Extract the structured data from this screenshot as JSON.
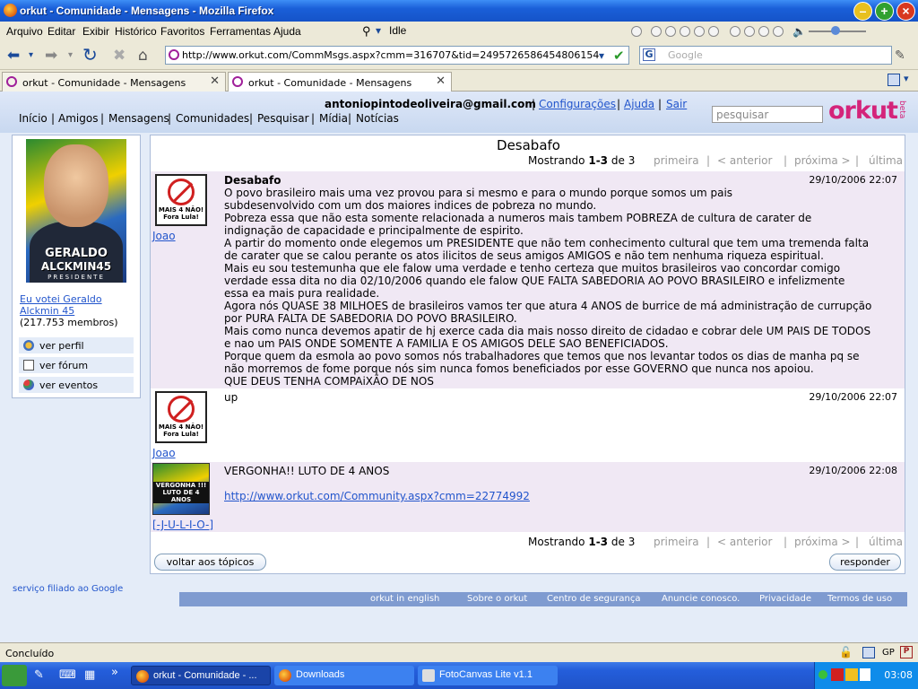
{
  "window": {
    "title": "orkut - Comunidade - Mensagens - Mozilla Firefox"
  },
  "menu": [
    "Arquivo",
    "Editar",
    "Exibir",
    "Histórico",
    "Favoritos",
    "Ferramentas",
    "Ajuda"
  ],
  "media_status": "Idle",
  "url": "http://www.orkut.com/CommMsgs.aspx?cmm=316707&tid=2495726586454806154",
  "search_placeholder": "Google",
  "tabs": [
    {
      "label": "orkut - Comunidade - Mensagens"
    },
    {
      "label": "orkut - Comunidade - Mensagens"
    }
  ],
  "header": {
    "email": "antoniopintodeoliveira@gmail.com",
    "links": [
      "Configurações",
      "Ajuda",
      "Sair"
    ],
    "nav": [
      "Início",
      "Amigos",
      "Mensagens",
      "Comunidades",
      "Pesquisar",
      "Mídia",
      "Notícias"
    ],
    "search_placeholder": "pesquisar",
    "logo": "orkut",
    "logo_beta": "beta"
  },
  "community": {
    "photo_text": [
      "GERALDO",
      "ALCKMIN45",
      "PRESIDENTE"
    ],
    "name": "Eu votei Geraldo Alckmin 45",
    "members": "(217.753 membros)",
    "actions": [
      "ver perfil",
      "ver fórum",
      "ver eventos"
    ]
  },
  "topic": {
    "title": "Desabafo",
    "pager": {
      "shown": "Mostrando",
      "range": "1-3",
      "of": "de",
      "total": "3",
      "first": "primeira",
      "prev": "< anterior",
      "next": "próxima >",
      "last": "última"
    },
    "posts": [
      {
        "author": "Joao",
        "avatar_text": [
          "MAIS 4 NÃO!",
          "Fora Lula!"
        ],
        "date": "29/10/2006 22:07",
        "subject": "Desabafo",
        "body": [
          "O povo brasileiro mais uma vez provou para si mesmo e para o mundo porque somos um pais",
          "subdesenvolvido com um dos maiores indices de pobreza no mundo.",
          "Pobreza essa que não esta somente relacionada a numeros mais tambem POBREZA de cultura de carater de",
          "indignação de capacidade e principalmente de espirito.",
          "A partir do momento onde elegemos um PRESIDENTE que não tem conhecimento cultural que tem uma tremenda falta",
          "de carater que se calou perante os atos ilicitos de seus amigos AMIGOS e não tem nenhuma riqueza espiritual.",
          "Mais eu sou testemunha que ele falow uma verdade e tenho certeza que muitos brasileiros vao concordar comigo",
          "verdade essa dita no dia 02/10/2006 quando ele falow QUE FALTA SABEDORIA AO POVO BRASILEIRO e infelizmente",
          "essa ea mais pura realidade.",
          "Agora nós QUASE 38 MILHOES de brasileiros vamos ter que atura 4 ANOS de burrice de má administração de currupção",
          "por PURA FALTA DE SABEDORIA DO POVO BRASILEIRO.",
          "Mais como nunca devemos apatir de hj exerce cada dia mais nosso direito de cidadao e cobrar dele UM PAIS DE TODOS",
          "e nao um PAIS ONDE SOMENTE A FAMILIA E OS AMIGOS DELE SAO BENEFICIADOS.",
          "Porque quem da esmola ao povo somos nós trabalhadores que temos que nos levantar todos os dias de manha pq se",
          "não morremos de fome porque nós sim nunca fomos beneficiados por esse GOVERNO que nunca nos apoiou.",
          "QUE DEUS TENHA COMPAiXÃO DE NOS"
        ]
      },
      {
        "author": "Joao",
        "avatar_text": [
          "MAIS 4 NÃO!",
          "Fora Lula!"
        ],
        "date": "29/10/2006 22:07",
        "body": [
          "up"
        ]
      },
      {
        "author": "[-J-U-L-I-O-]",
        "avatar_text": [
          "VERGONHA !!!",
          "LUTO DE 4 ANOS"
        ],
        "date": "29/10/2006 22:08",
        "body": [
          "VERGONHA!! LUTO DE 4 ANOS"
        ],
        "link": "http://www.orkut.com/Community.aspx?cmm=22774992"
      }
    ],
    "back_button": "voltar aos tópicos",
    "reply_button": "responder"
  },
  "footer": {
    "affiliate": "serviço filiado ao Google",
    "links": [
      "orkut in english",
      "Sobre o orkut",
      "Centro de segurança",
      "Anuncie conosco.",
      "Privacidade",
      "Termos de uso"
    ]
  },
  "status": "Concluído",
  "status_tray": "GP",
  "taskbar": {
    "items": [
      "orkut - Comunidade - ...",
      "Downloads",
      "FotoCanvas Lite v1.1"
    ],
    "clock": "03:08"
  },
  "colors": {
    "orkut_pink": "#d4247a",
    "link": "#2255cc",
    "header_bg": "#c8d8f0",
    "post_alt": "#f0e8f4"
  }
}
